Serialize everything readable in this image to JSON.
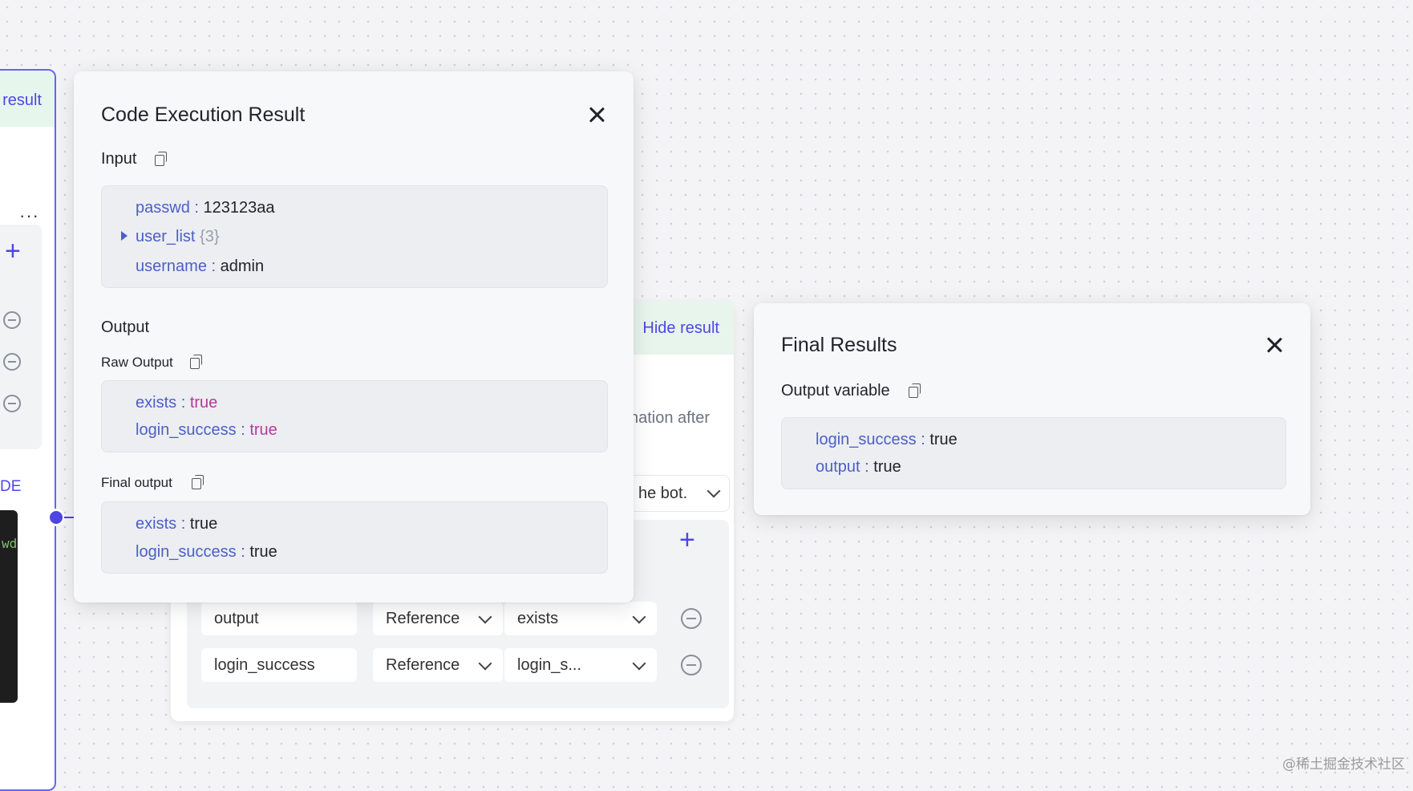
{
  "left_node": {
    "result_tab": "result",
    "section_label": "DE",
    "code_snippet": "wd"
  },
  "code_result_panel": {
    "title": "Code Execution Result",
    "input": {
      "label": "Input",
      "items": [
        {
          "key": "passwd",
          "sep": ":",
          "value": "123123aa"
        },
        {
          "key": "user_list",
          "count": "{3}"
        },
        {
          "key": "username",
          "sep": ":",
          "value": "admin"
        }
      ]
    },
    "output_label": "Output",
    "raw_output": {
      "label": "Raw Output",
      "items": [
        {
          "key": "exists",
          "sep": ":",
          "value": "true"
        },
        {
          "key": "login_success",
          "sep": ":",
          "value": "true"
        }
      ]
    },
    "final_output": {
      "label": "Final output",
      "items": [
        {
          "key": "exists",
          "sep": ":",
          "value": "true"
        },
        {
          "key": "login_success",
          "sep": ":",
          "value": "true"
        }
      ]
    }
  },
  "end_node": {
    "hide_result": "Hide result",
    "description_fragment": "nation after",
    "select_fragment": "he bot.",
    "rows": [
      {
        "name": "output",
        "type": "Reference",
        "ref": "exists"
      },
      {
        "name": "login_success",
        "type": "Reference",
        "ref": "login_s..."
      }
    ]
  },
  "final_results_panel": {
    "title": "Final Results",
    "label": "Output variable",
    "items": [
      {
        "key": "login_success",
        "sep": ":",
        "value": "true"
      },
      {
        "key": "output",
        "sep": ":",
        "value": "true"
      }
    ]
  },
  "watermark": "@稀土掘金技术社区",
  "colors": {
    "accent": "#4f46e5",
    "key_blue": "#4c5fc7",
    "bool_magenta": "#b8389b",
    "result_tab_green": "#e6f6ec"
  }
}
